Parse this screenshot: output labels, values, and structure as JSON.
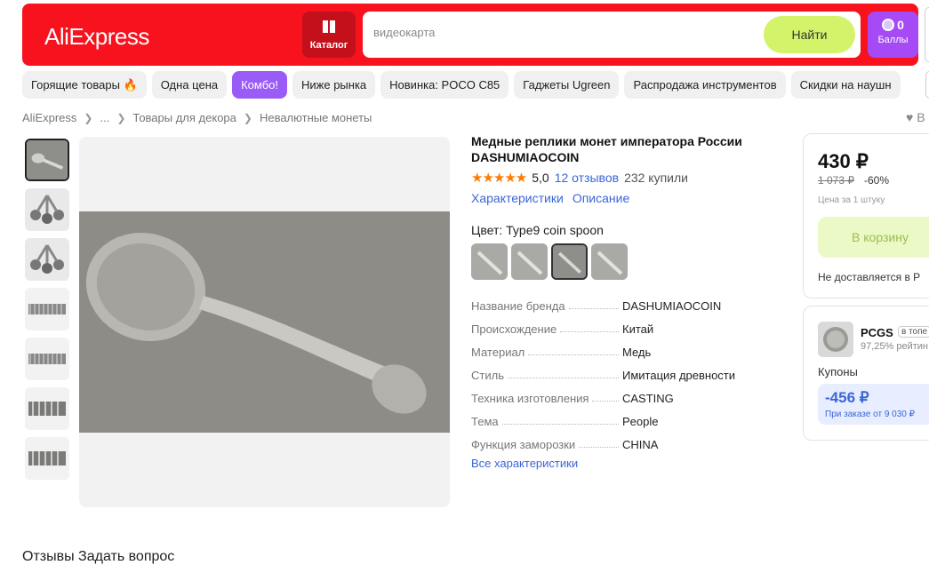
{
  "header": {
    "logo": "AliExpress",
    "catalog_label": "Каталог",
    "search_value": "видеокарта",
    "search_button": "Найти",
    "points_count": "0",
    "points_label": "Баллы",
    "brand_color": "#f8121e"
  },
  "tags": [
    "Горящие товары 🔥",
    "Одна цена",
    "Комбо!",
    "Ниже рынка",
    "Новинка: POCO C85",
    "Гаджеты Ugreen",
    "Распродажа инструментов",
    "Скидки на наушн"
  ],
  "breadcrumb": [
    "AliExpress",
    "...",
    "Товары для декора",
    "Невалютные монеты"
  ],
  "product": {
    "title": "Медные реплики монет императора России DASHUMIAOCOIN",
    "stars": "★★★★★",
    "rating": "5,0",
    "reviews": "12 отзывов",
    "bought": "232 купили",
    "link_specs": "Характеристики",
    "link_desc": "Описание",
    "color_label": "Цвет: Type9 coin spoon",
    "specs": [
      {
        "key": "Название бренда",
        "value": "DASHUMIAOCOIN"
      },
      {
        "key": "Происхождение",
        "value": "Китай"
      },
      {
        "key": "Материал",
        "value": "Медь"
      },
      {
        "key": "Стиль",
        "value": "Имитация древности"
      },
      {
        "key": "Техника изготовления",
        "value": "CASTING"
      },
      {
        "key": "Тема",
        "value": "People"
      },
      {
        "key": "Функция заморозки",
        "value": "CHINA"
      }
    ],
    "all_specs": "Все характеристики"
  },
  "buy": {
    "price": "430 ₽",
    "old_price": "1 073 ₽",
    "discount": "-60%",
    "unit": "Цена за 1 штуку",
    "cart_button": "В корзину",
    "delivery": "Не доставляется в Р"
  },
  "seller": {
    "name": "PCGS",
    "badge": "в топе",
    "rating": "97,25% рейтин",
    "coupons_label": "Купоны",
    "coupon_value": "-456 ₽",
    "coupon_condition": "При заказе от 9 030 ₽"
  },
  "favorite": "♥ В",
  "bottom": "Отзывы   Задать вопрос"
}
